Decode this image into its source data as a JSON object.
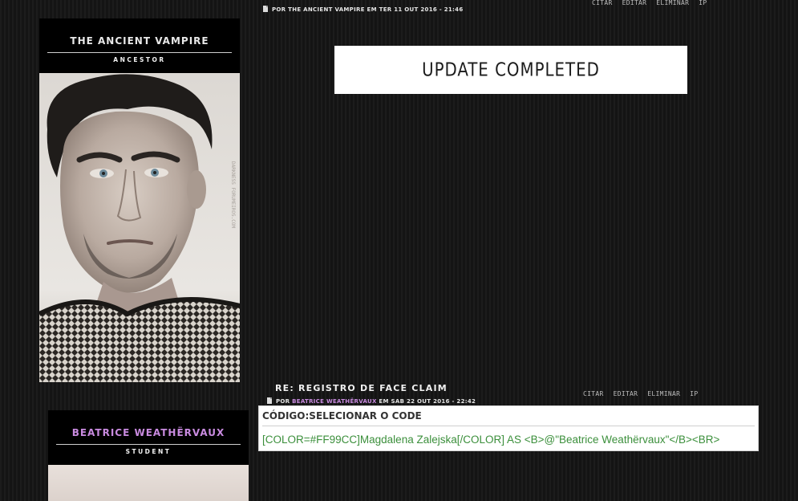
{
  "post1": {
    "author_line": {
      "prefix": "POR",
      "author": "THE ANCIENT VAMPIRE",
      "middle": "EM",
      "date": "TER 11 OUT 2016 - 21:46"
    },
    "actions": [
      "CITAR",
      "EDITAR",
      "ELIMINAR",
      "IP"
    ],
    "banner_text": "UPDATE COMPLETED"
  },
  "profile1": {
    "name": "THE ANCIENT VAMPIRE",
    "rank": "ANCESTOR",
    "name_color": "#e8e8e8",
    "photo_watermark": "DARKNESS FORUMEIROS.COM"
  },
  "post2": {
    "title": "RE: REGISTRO DE FACE CLAIM",
    "author_line": {
      "prefix": "POR",
      "author": "BEATRICE WEATHËRVAUX",
      "middle": "EM",
      "date": "SAB 22 OUT 2016 - 22:42"
    },
    "author_color": "#c98be0",
    "actions": [
      "CITAR",
      "EDITAR",
      "ELIMINAR",
      "IP"
    ],
    "codebox": {
      "label": "CÓDIGO:",
      "select_label": "SELECIONAR O CODE",
      "code": "[COLOR=#FF99CC]Magdalena Zalejska[/COLOR] AS <B>@\"Beatrice Weathërvaux\"</B><BR>"
    }
  },
  "profile2": {
    "name": "BEATRICE WEATHËRVAUX",
    "rank": "STUDENT",
    "name_color": "#c98be0"
  }
}
